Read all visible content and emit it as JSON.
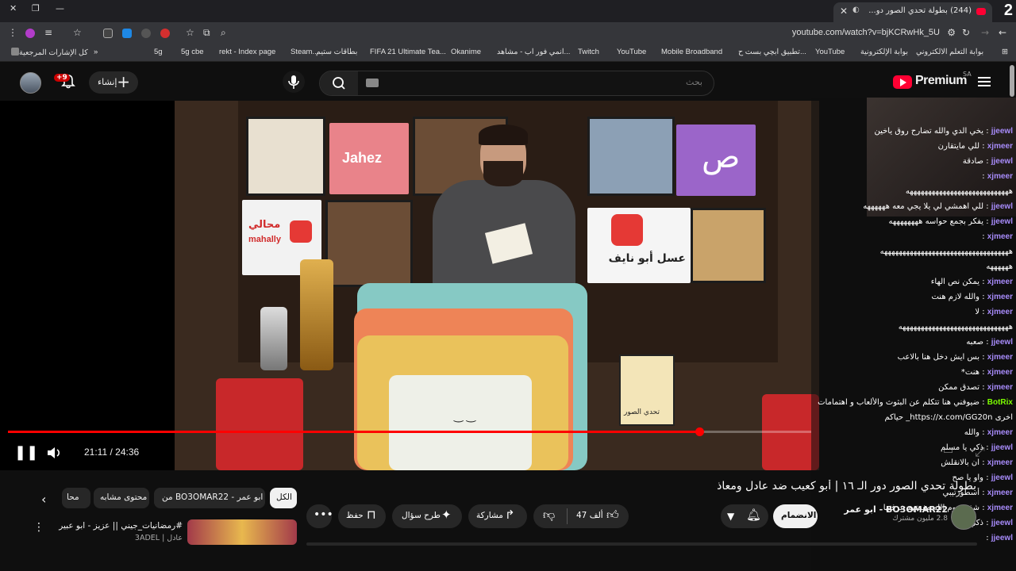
{
  "browser": {
    "tab_count": "2",
    "active_tab_title": "(244) بطولة تحدي الصور دو...",
    "url": "youtube.com/watch?v=bjKCRwHk_5U",
    "bookmarks": [
      "كل الإشارات المرجعية",
      "5g",
      "5g cbe",
      "rekt - Index page",
      "Steam...",
      "بطاقات ستيم",
      "FIFA 21 Ultimate Tea...",
      "Okanime",
      "انمي فور اب - مشاهد...",
      "Twitch",
      "YouTube",
      "Mobile Broadband",
      "تطبيق ابچي بست ح...",
      "YouTube",
      "بوابة الإلكترونية",
      "بوابة التعلم الالكتروني"
    ]
  },
  "youtube": {
    "notification_badge": "+9",
    "create_label": "إنشاء",
    "search_placeholder": "بحث",
    "logo_text": "Premium",
    "region": "SA"
  },
  "player": {
    "time_display": "21:11 / 24:36",
    "progress_fraction": 0.861,
    "poster_texts": [
      "Jahez",
      "محالي",
      "mahally",
      "عسل أبو نايف",
      "تحدي الصور"
    ]
  },
  "chat": [
    {
      "user": "jjeewl",
      "text": "يخي الدي والله تضارح روق ياخين"
    },
    {
      "user": "xjmeer",
      "text": "للي مايتقارن"
    },
    {
      "user": "jjeewl",
      "text": "صادقة"
    },
    {
      "user": "xjmeer",
      "text": ""
    },
    {
      "user": "",
      "text": "ههههههههههههههههههههههههههههه"
    },
    {
      "user": "jjeewl",
      "text": "للي اهمشي لي يلا يجي معه ههههههه"
    },
    {
      "user": "jjeewl",
      "text": "يفكر بجمع حواسه ههههههههه"
    },
    {
      "user": "xjmeer",
      "text": ""
    },
    {
      "user": "",
      "text": "هههههههههههههههههههههههههههههههههههه"
    },
    {
      "user": "",
      "text": "ههههههه"
    },
    {
      "user": "xjmeer",
      "text": "يمكن نص الهاء"
    },
    {
      "user": "xjmeer",
      "text": "والله لازم هنت"
    },
    {
      "user": "xjmeer",
      "text": "لا"
    },
    {
      "user": "",
      "text": "ههههههههههههههههههههههههههههههه"
    },
    {
      "user": "jjeewl",
      "text": "صعبه"
    },
    {
      "user": "xjmeer",
      "text": "بس ايش دخل هنا بالاعب"
    },
    {
      "user": "xjmeer",
      "text": "هنت*"
    },
    {
      "user": "xjmeer",
      "text": "تصدق ممكن"
    },
    {
      "user": "BotRix",
      "text": "ضيوفني هنا تتكلم عن البثوث والألعاب و اهتمامات"
    },
    {
      "user": "",
      "text": "اخرى https://x.com/GG20n_ حياكم"
    },
    {
      "user": "xjmeer",
      "text": "والله"
    },
    {
      "user": "jjeewl",
      "text": "ذكي يا مسلم"
    },
    {
      "user": "xjmeer",
      "text": "ان بالانقلش"
    },
    {
      "user": "jjeewl",
      "text": "واو يا صح"
    },
    {
      "user": "xjmeer",
      "text": "أسطورتيبي"
    },
    {
      "user": "xjmeer",
      "text": "شفت يوم الله مفدتهم عرفتها"
    },
    {
      "user": "jjeewl",
      "text": "ذكي"
    },
    {
      "user": "jjeewl",
      "text": ""
    }
  ],
  "video": {
    "title": "بطولة تحدي الصور دور الـ ١٦ | أبو كعيب ضد عادل ومعاذ",
    "channel": "BO3OMAR22 - ابو عمر",
    "subscribers": "2.8 مليون مشترك",
    "join_label": "الانضمام",
    "likes": "47 ألف",
    "share_label": "مشاركة",
    "ask_label": "طرح سؤال",
    "save_label": "حفظ"
  },
  "chips": [
    "الكل",
    "من BO3OMAR22 - ابو عمر",
    "محتوى مشابه",
    "محا"
  ],
  "related": {
    "title": "#رمضانيات_جيني || عزيز - ابو عبير",
    "channel": "عادل | 3ADEL"
  }
}
